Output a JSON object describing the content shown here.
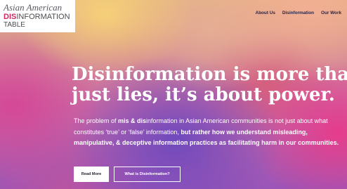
{
  "brand": {
    "line1": "Asian American",
    "dis": "DIS",
    "information": "INFORMATION",
    "line3": "TABLE"
  },
  "nav": {
    "items": [
      "About Us",
      "Disinformation",
      "Our Work"
    ]
  },
  "hero": {
    "headline_line1": "Disinformation is more than",
    "headline_line2": "just lies, it’s about power.",
    "para_1": "The problem of ",
    "para_2": "mis & dis",
    "para_3": "information in Asian American communities is not just about what constitutes ‘true’ or ‘false’ information, ",
    "para_4": "but rather how we understand misleading, manipulative, & deceptive information practices as facilitating harm in our communities.",
    "button_primary": "Read More",
    "button_secondary": "What is Disinformation?"
  },
  "colors": {
    "accent": "#d6285e",
    "button_text": "#2a2333"
  }
}
